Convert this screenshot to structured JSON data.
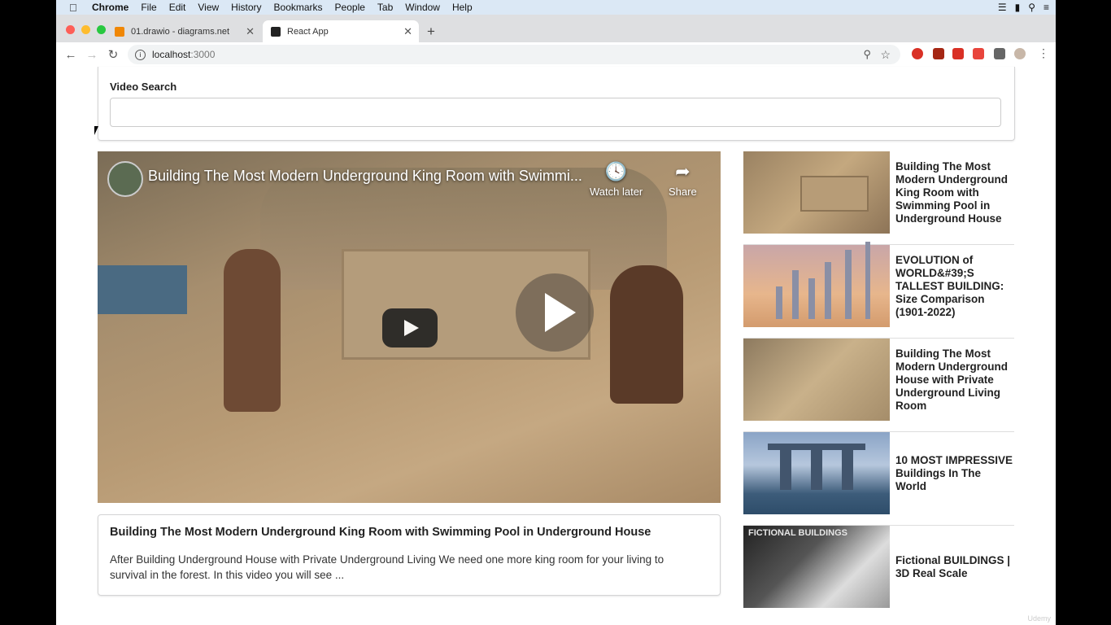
{
  "macmenu": {
    "app": "Chrome",
    "items": [
      "File",
      "Edit",
      "View",
      "History",
      "Bookmarks",
      "People",
      "Tab",
      "Window",
      "Help"
    ]
  },
  "tabs": [
    {
      "label": "01.drawio - diagrams.net",
      "favicon_color": "#f08705"
    },
    {
      "label": "React App",
      "favicon_color": "#222222"
    }
  ],
  "address": {
    "host": "localhost",
    "port": ":3000"
  },
  "search": {
    "label": "Video Search",
    "value": ""
  },
  "player": {
    "title": "Building The Most Modern Underground King Room with Swimmi...",
    "watch_later": "Watch later",
    "share": "Share"
  },
  "detail": {
    "title": "Building The Most Modern Underground King Room with Swimming Pool in Underground House",
    "description": "After Building Underground House with Private Underground Living We need one more king room for your living to survival in the forest. In this video you will see ..."
  },
  "videos": [
    {
      "title": "Building The Most Modern Underground King Room with Swimming Pool in Underground House"
    },
    {
      "title": "EVOLUTION of WORLD&#39;S TALLEST BUILDING: Size Comparison (1901-2022)"
    },
    {
      "title": "Building The Most Modern Underground House with Private Underground Living Room"
    },
    {
      "title": "10 MOST IMPRESSIVE Buildings In The World"
    },
    {
      "title": "Fictional BUILDINGS | 3D Real Scale",
      "thumb_text": "FICTIONAL BUILDINGS"
    }
  ],
  "watermark": "Udemy",
  "colors": {
    "accent": "#1a73e8",
    "border": "#d4d4d5"
  }
}
